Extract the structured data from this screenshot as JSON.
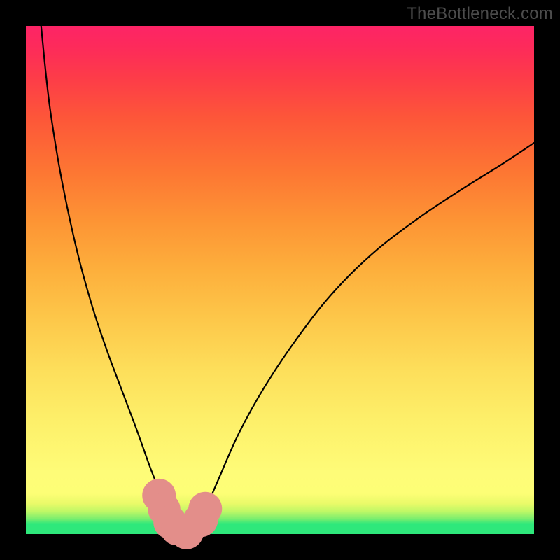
{
  "watermark": "TheBottleneck.com",
  "chart_data": {
    "type": "line",
    "title": "",
    "xlabel": "",
    "ylabel": "",
    "xlim": [
      0,
      100
    ],
    "ylim": [
      0,
      100
    ],
    "series": [
      {
        "name": "left-curve",
        "x": [
          3,
          4,
          5,
          7,
          10,
          13,
          16,
          19,
          22,
          24.5,
          26.5,
          28,
          29,
          29.8
        ],
        "y": [
          100,
          90,
          82,
          70,
          56,
          45,
          36,
          28,
          20,
          13,
          8,
          4,
          2,
          0.5
        ]
      },
      {
        "name": "right-curve",
        "x": [
          33.5,
          35,
          38,
          42,
          47,
          53,
          60,
          68,
          77,
          86,
          94,
          100
        ],
        "y": [
          0.5,
          4,
          11,
          20,
          29,
          38,
          47,
          55,
          62,
          68,
          73,
          77
        ]
      }
    ],
    "markers": [
      {
        "name": "m1",
        "x": 26.2,
        "y": 7.6,
        "r": 3.3
      },
      {
        "name": "m2",
        "x": 27.2,
        "y": 4.9,
        "r": 3.2
      },
      {
        "name": "m3",
        "x": 28.4,
        "y": 2.3,
        "r": 3.3
      },
      {
        "name": "m4",
        "x": 29.6,
        "y": 0.8,
        "r": 3.0
      },
      {
        "name": "m5",
        "x": 31.6,
        "y": 0.4,
        "r": 3.4
      },
      {
        "name": "m6",
        "x": 34.4,
        "y": 2.8,
        "r": 3.4
      },
      {
        "name": "m7",
        "x": 35.3,
        "y": 5.0,
        "r": 3.3
      }
    ]
  }
}
